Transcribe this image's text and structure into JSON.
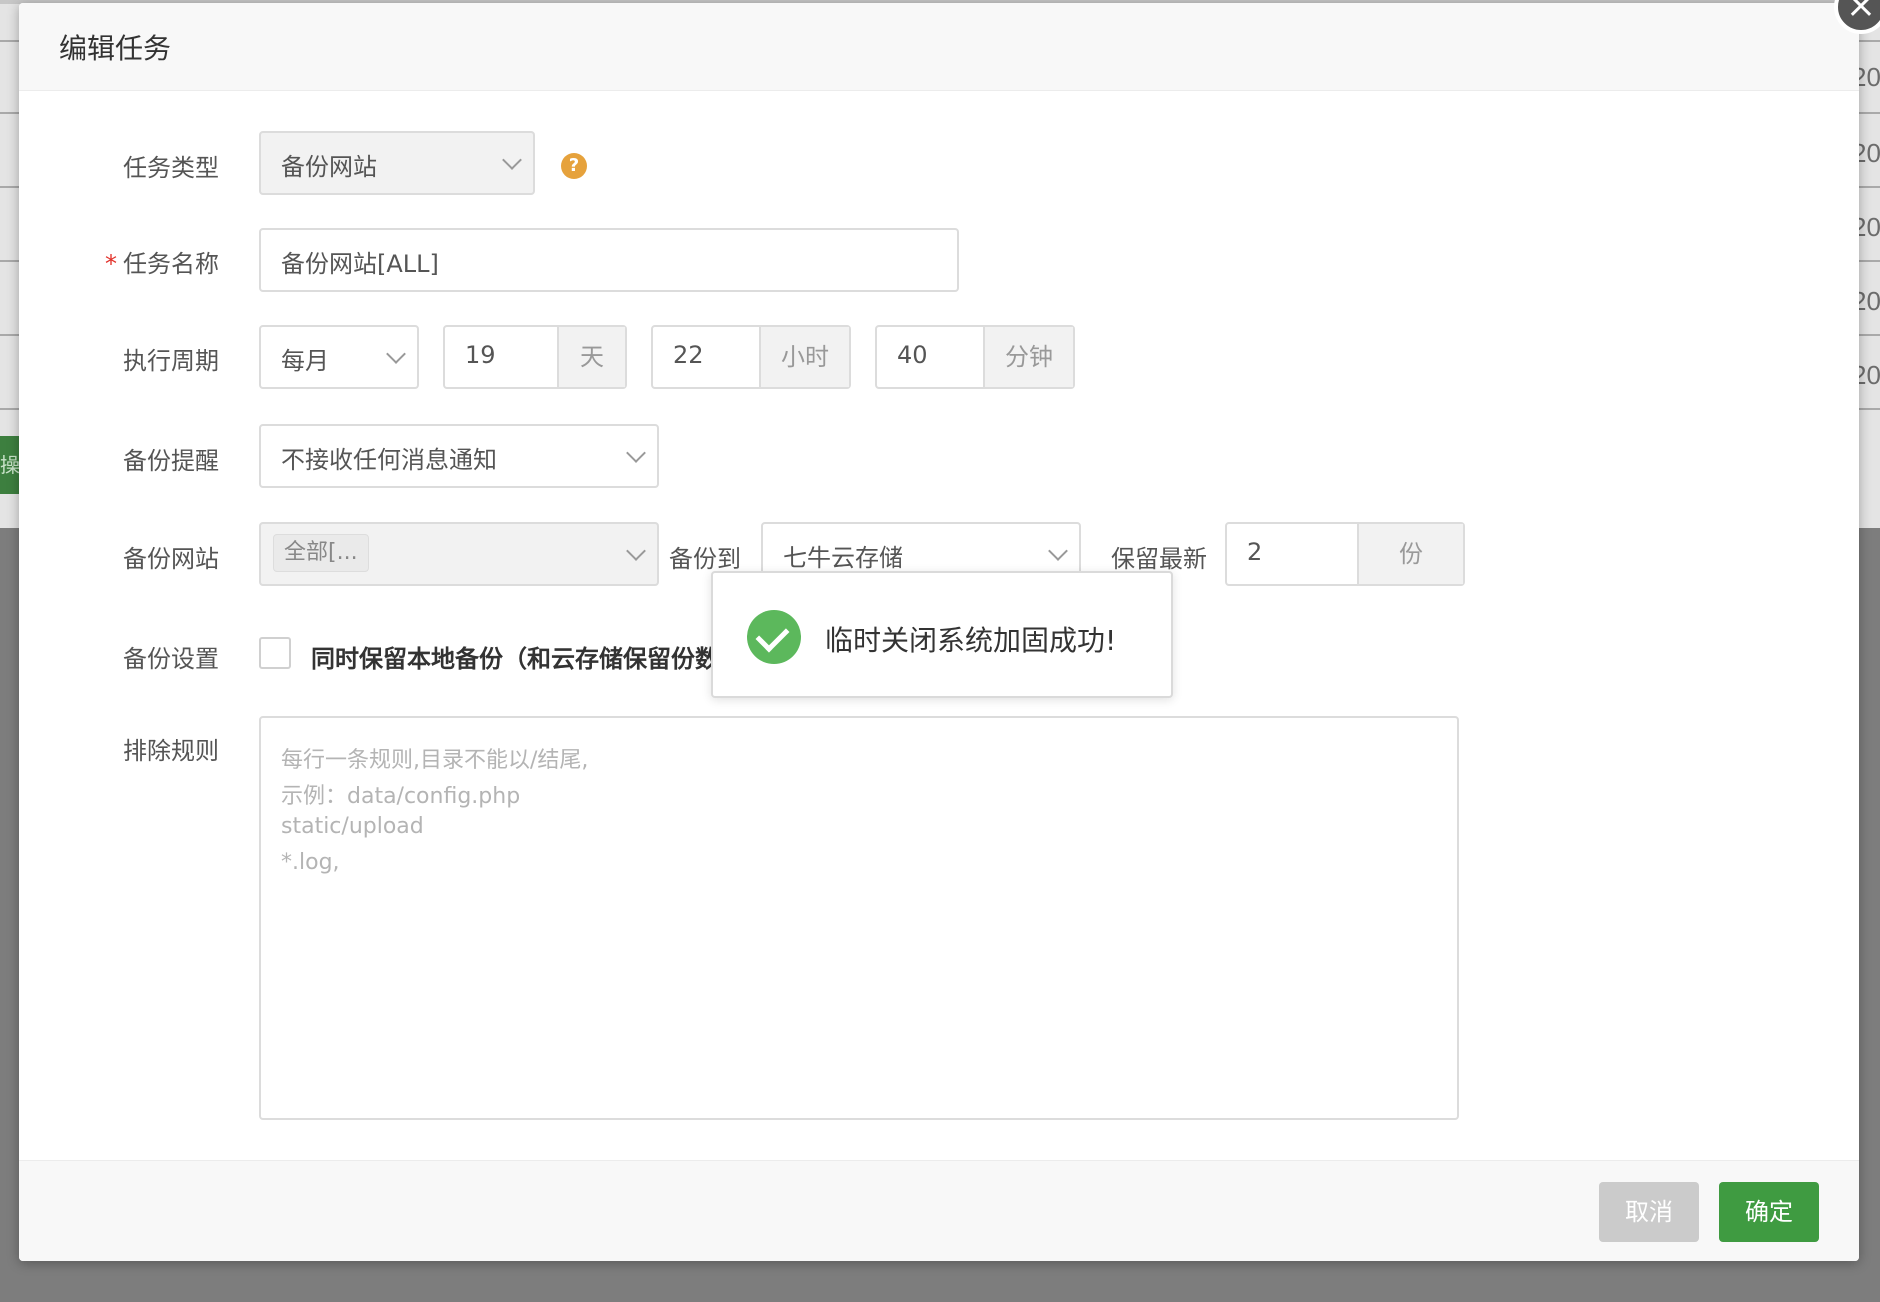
{
  "background": {
    "row_values": [
      "20",
      "20",
      "20",
      "20",
      "20"
    ],
    "side_button": "操"
  },
  "dialog": {
    "title": "编辑任务",
    "close_glyph": "×"
  },
  "form": {
    "task_type": {
      "label": "任务类型",
      "value": "备份网站"
    },
    "help_glyph": "?",
    "task_name": {
      "label": "任务名称",
      "required_mark": "*",
      "value": "备份网站[ALL]"
    },
    "cycle": {
      "label": "执行周期",
      "period": "每月",
      "day": "19",
      "day_unit": "天",
      "hour": "22",
      "hour_unit": "小时",
      "minute": "40",
      "minute_unit": "分钟"
    },
    "notify": {
      "label": "备份提醒",
      "value": "不接收任何消息通知"
    },
    "site": {
      "label": "备份网站",
      "tag": "全部[...",
      "backup_to_label": "备份到",
      "backup_to": "七牛云存储",
      "keep_label": "保留最新",
      "keep_value": "2",
      "keep_unit": "份"
    },
    "settings": {
      "label": "备份设置",
      "checkbox_label": "同时保留本地备份（和云存储保留份数"
    },
    "exclude": {
      "label": "排除规则",
      "placeholder_lines": [
        "每行一条规则,目录不能以/结尾,",
        "示例：data/config.php",
        "static/upload",
        "*.log,"
      ]
    }
  },
  "toast": {
    "message": "临时关闭系统加固成功!"
  },
  "footer": {
    "cancel": "取消",
    "confirm": "确定"
  },
  "colors": {
    "accent": "#3f9b41",
    "success": "#5cb85c",
    "required": "#e2322b",
    "help": "#e6a23c"
  }
}
